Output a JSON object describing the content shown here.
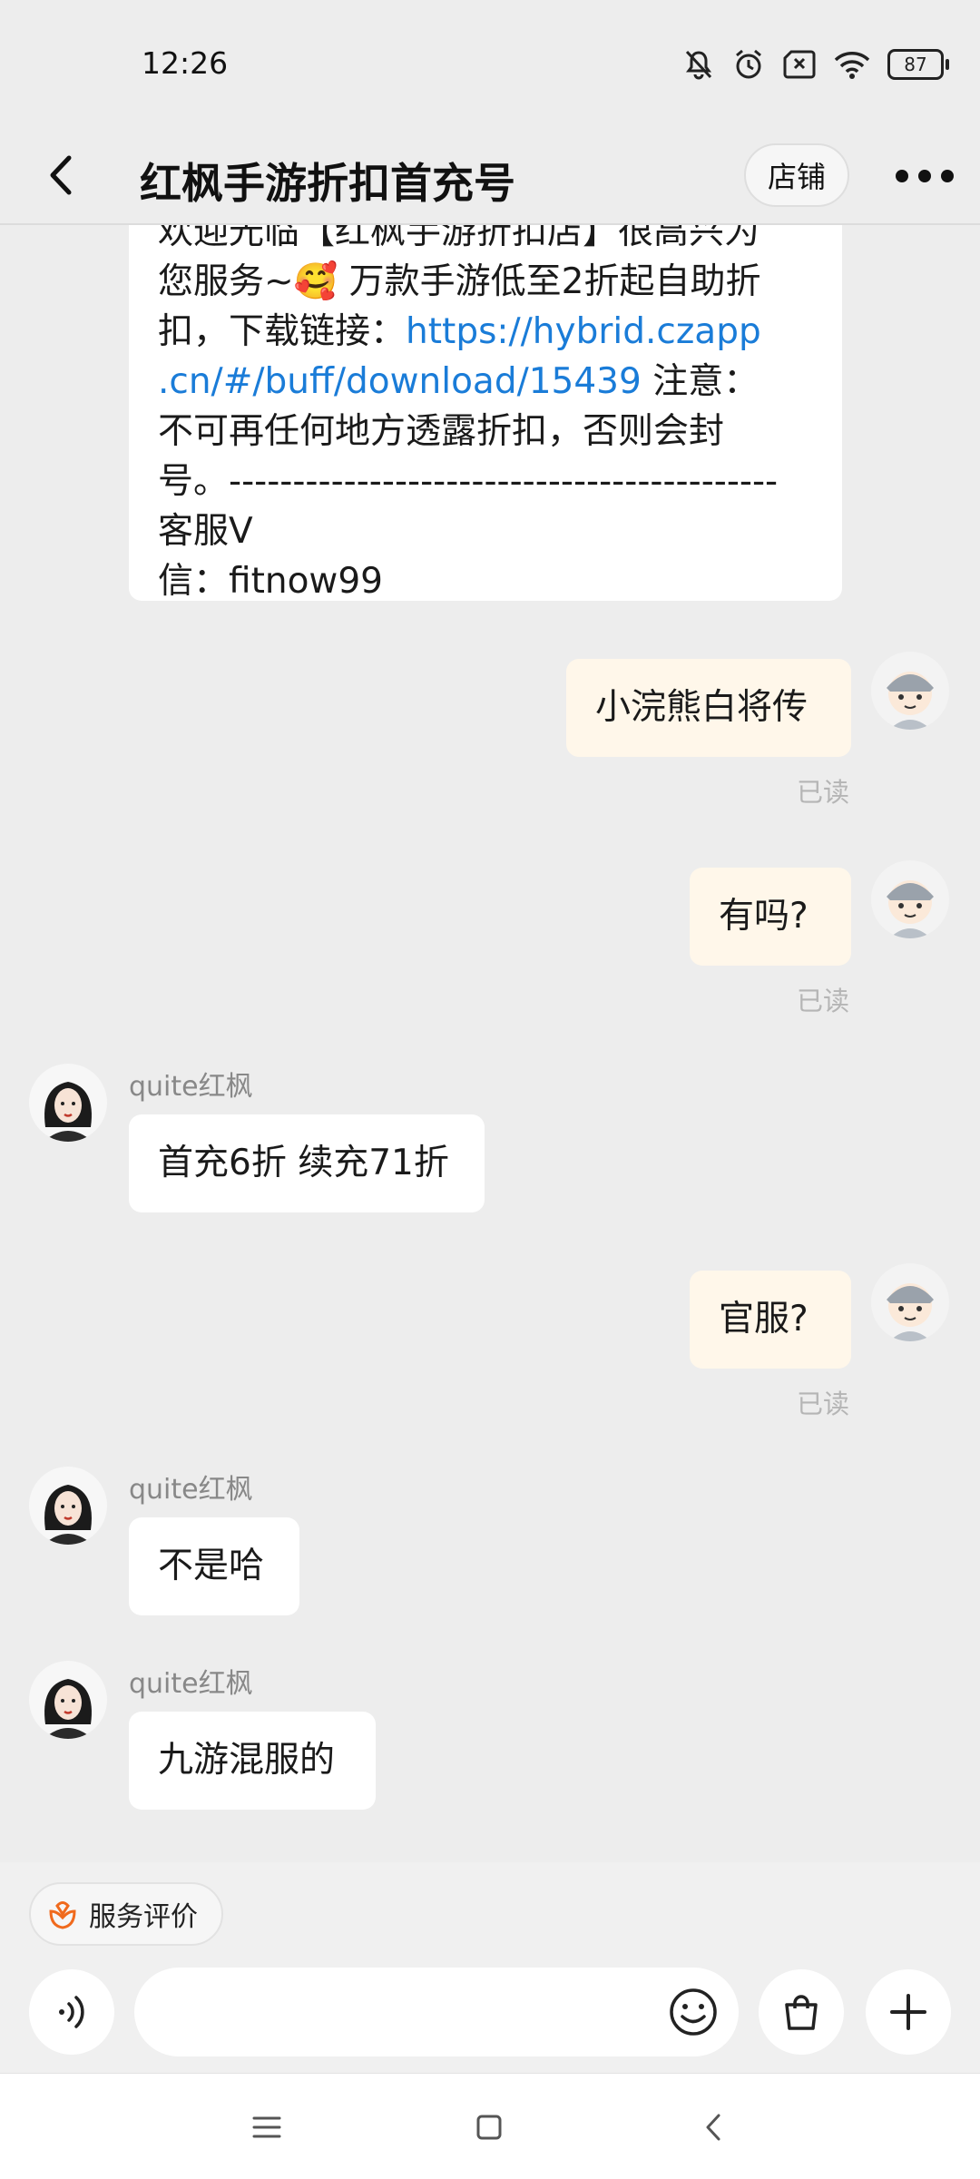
{
  "status": {
    "time": "12:26",
    "battery": "87"
  },
  "header": {
    "title": "红枫手游折扣首充号",
    "shop_label": "店铺"
  },
  "messages": {
    "welcome": {
      "line_a": "欢迎光临【红枫手游折扣店】很高兴为",
      "line_b_pre": "您服务~",
      "emoji": "🥰",
      "line_b_post": " 万款手游低至2折起自助折",
      "line_c_pre": "扣，下载链接：",
      "link_a": "https://hybrid.czapp",
      "link_b": ".cn/#/buff/download/15439",
      "line_d_post": " 注意：",
      "line_e": "不可再任何地方透露折扣，否则会封",
      "line_f": "号。------------------------------------------- 客服V",
      "line_g": "信：fitnow99"
    },
    "m1": "小浣熊白将传",
    "m1_read": "已读",
    "m2": "有吗?",
    "m2_read": "已读",
    "sender1": "quite红枫",
    "m3": "首充6折 续充71折",
    "m4": "官服?",
    "m4_read": "已读",
    "sender2": "quite红枫",
    "m5": "不是哈",
    "sender3": "quite红枫",
    "m6": "九游混服的"
  },
  "bottom": {
    "service_rating": "服务评价"
  },
  "icons": {
    "back": "back-arrow-icon",
    "more": "more-dots-icon",
    "voice": "voice-icon",
    "emoji": "emoji-icon",
    "bag": "shopping-bag-icon",
    "plus": "plus-icon"
  },
  "colors": {
    "link": "#1a7cd8",
    "self_bubble": "#fff7ea",
    "accent": "#f06a1d"
  }
}
